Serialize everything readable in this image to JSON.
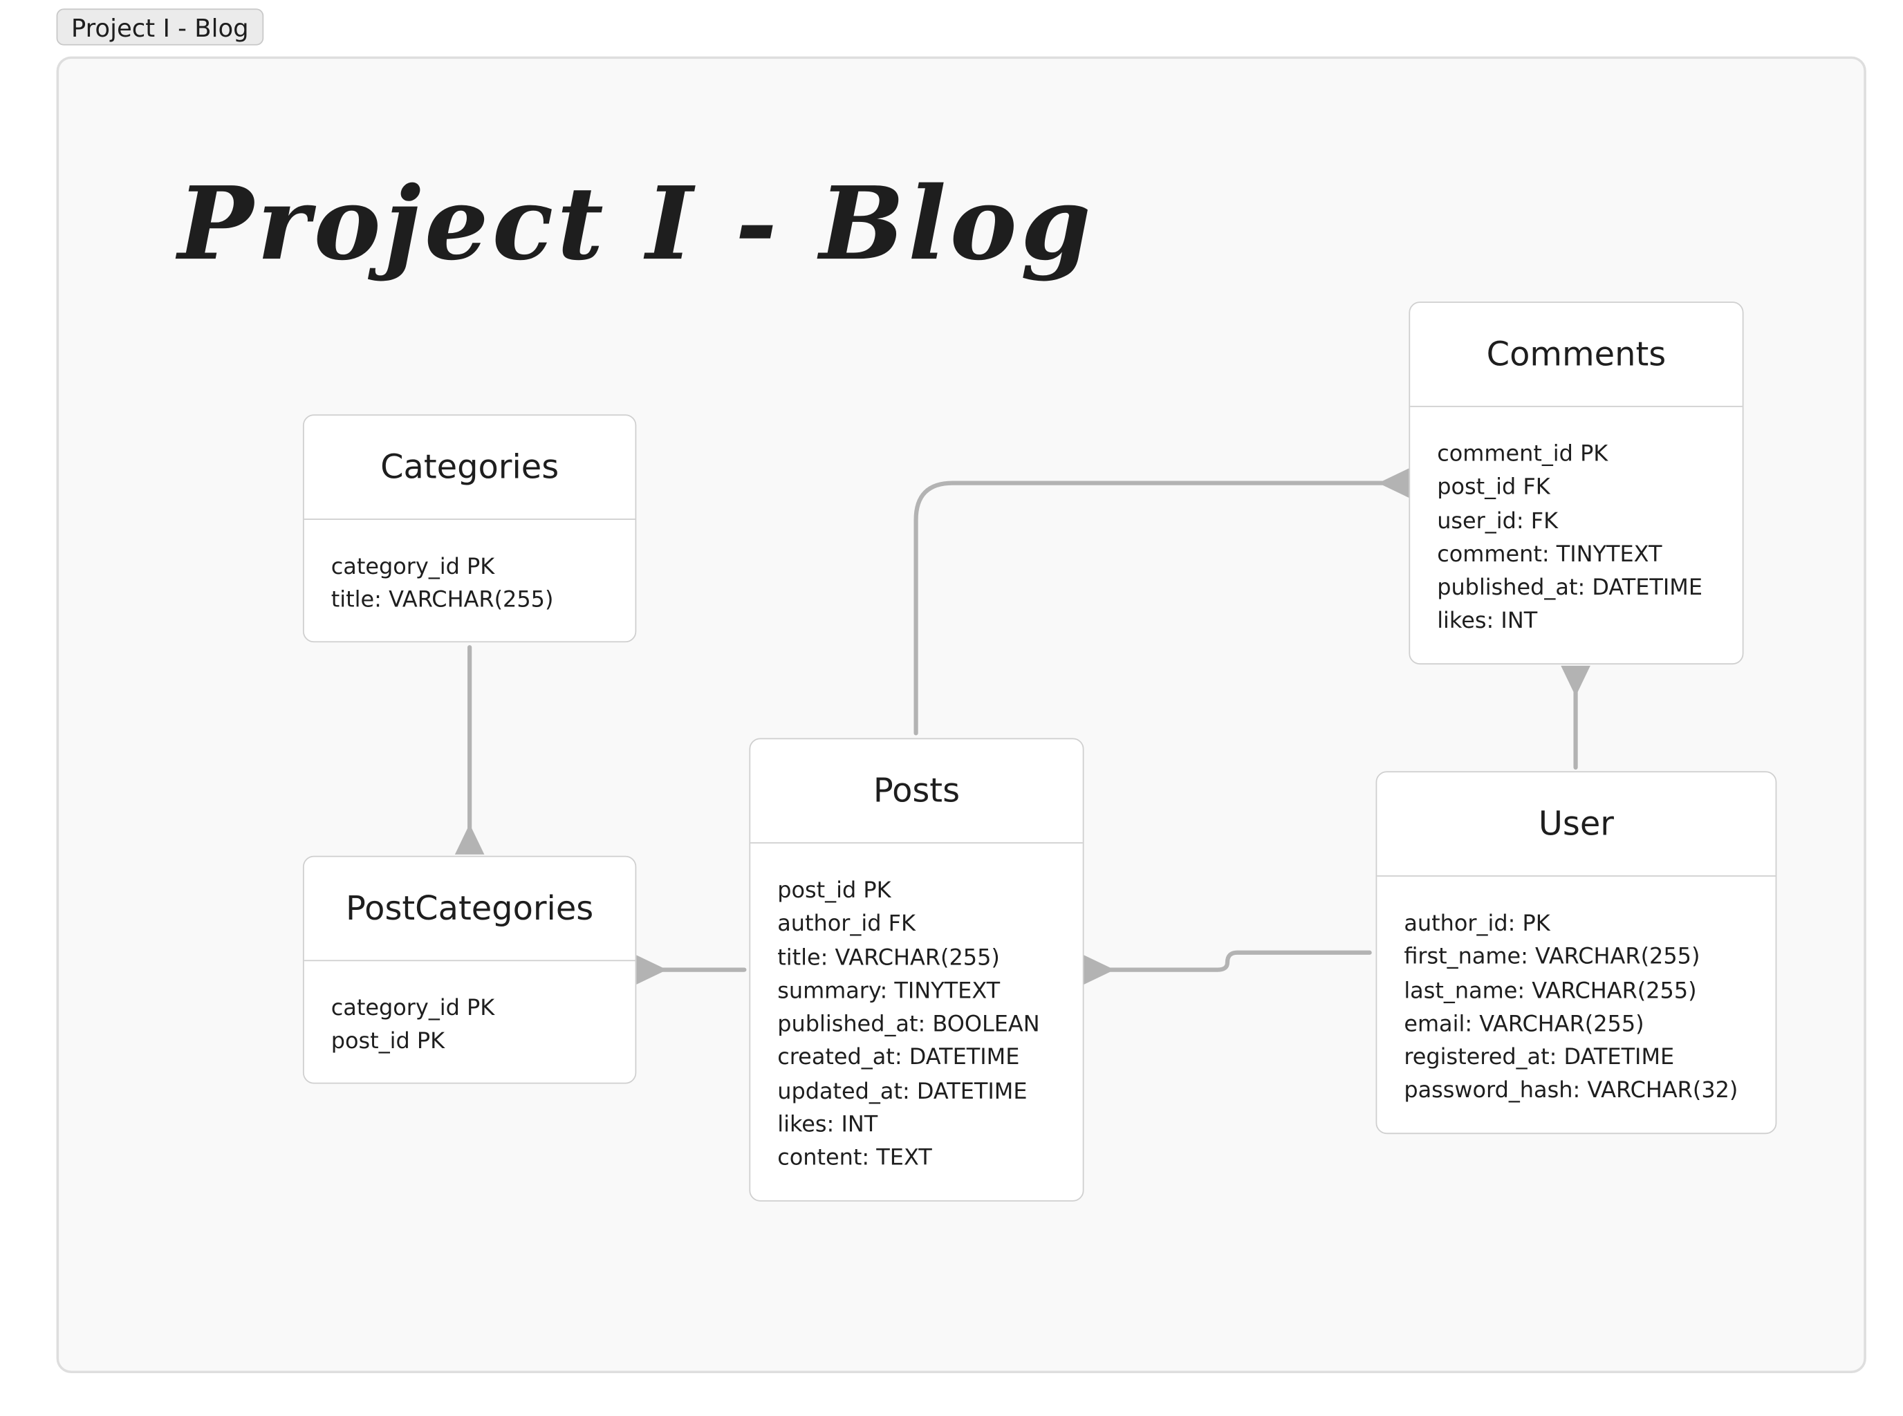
{
  "frame": {
    "label": "Project I - Blog",
    "title": "Project I - Blog"
  },
  "colors": {
    "background": "#ffffff",
    "frame_fill": "#f9f9f9",
    "frame_border": "#dedede",
    "entity_border": "#cfcfcf",
    "connector": "#b3b3b3",
    "text": "#1e1e1e"
  },
  "entities": {
    "categories": {
      "name": "Categories",
      "fields": [
        "category_id PK",
        "title: VARCHAR(255)"
      ]
    },
    "post_categories": {
      "name": "PostCategories",
      "fields": [
        "category_id PK",
        "post_id PK"
      ]
    },
    "posts": {
      "name": "Posts",
      "fields": [
        "post_id PK",
        "author_id FK",
        "title: VARCHAR(255)",
        "summary: TINYTEXT",
        "published_at: BOOLEAN",
        "created_at: DATETIME",
        "updated_at: DATETIME",
        "likes: INT",
        "content: TEXT"
      ]
    },
    "comments": {
      "name": "Comments",
      "fields": [
        "comment_id PK",
        "post_id FK",
        "user_id: FK",
        "comment: TINYTEXT",
        "published_at: DATETIME",
        "likes: INT"
      ]
    },
    "user": {
      "name": "User",
      "fields": [
        "author_id: PK",
        "first_name: VARCHAR(255)",
        "last_name: VARCHAR(255)",
        "email: VARCHAR(255)",
        "registered_at: DATETIME",
        "password_hash: VARCHAR(32)"
      ]
    }
  },
  "relationships": [
    {
      "from": "Categories",
      "to": "PostCategories",
      "arrowhead_at": "PostCategories"
    },
    {
      "from": "Posts",
      "to": "PostCategories",
      "arrowhead_at": "PostCategories"
    },
    {
      "from": "Posts",
      "to": "Comments",
      "arrowhead_at": "Comments"
    },
    {
      "from": "User",
      "to": "Comments",
      "arrowhead_at": "Comments"
    },
    {
      "from": "User",
      "to": "Posts",
      "arrowhead_at": "Posts"
    }
  ]
}
